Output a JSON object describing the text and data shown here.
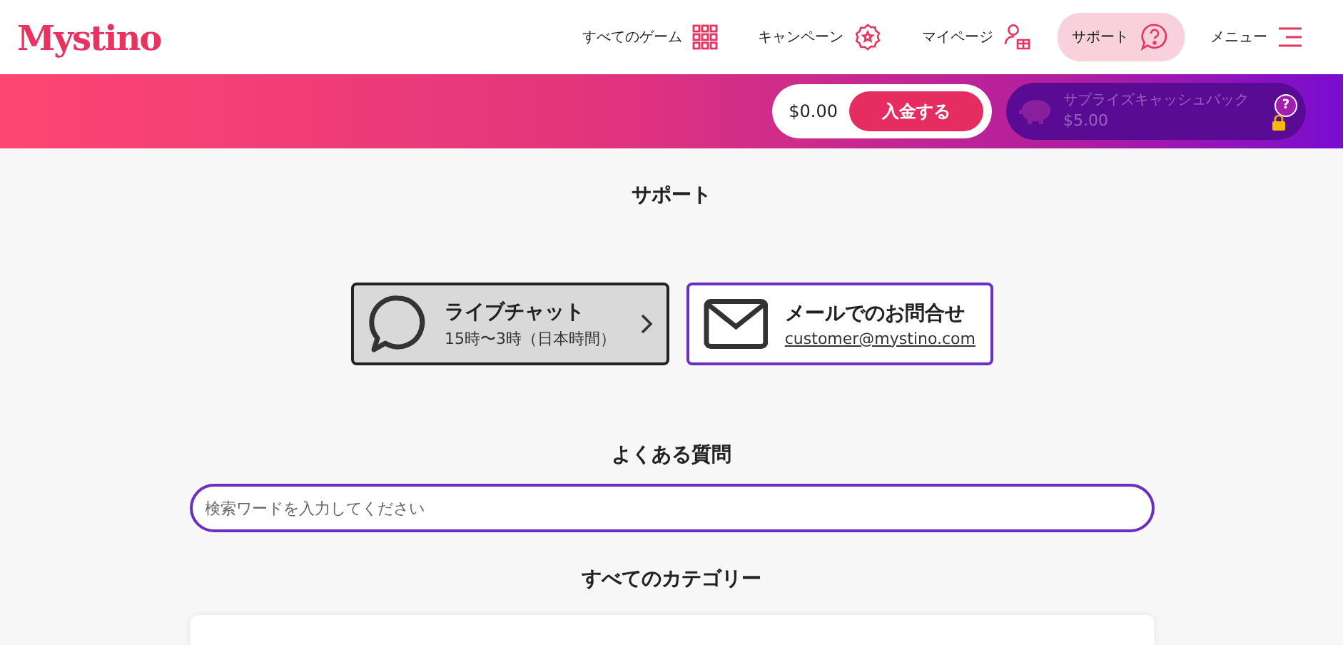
{
  "logo": "Mystino",
  "nav": [
    {
      "label": "すべてのゲーム",
      "kind": "grid",
      "selected": false
    },
    {
      "label": "キャンペーン",
      "kind": "badge",
      "selected": false
    },
    {
      "label": "マイページ",
      "kind": "user",
      "selected": false
    },
    {
      "label": "サポート",
      "kind": "help",
      "selected": true
    },
    {
      "label": "メニュー",
      "kind": "menu",
      "selected": false
    }
  ],
  "balance": {
    "amount": "$0.00",
    "deposit_button": "入金する"
  },
  "cashback": {
    "title": "サプライズキャッシュバック",
    "amount": "$5.00",
    "locked": true,
    "help": "?"
  },
  "page_title": "サポート",
  "contacts": [
    {
      "kind": "chat",
      "title": "ライブチャット",
      "subtitle": "15時〜3時（日本時間）"
    },
    {
      "kind": "mail",
      "title": "メールでのお問合せ",
      "subtitle": "customer@mystino.com"
    }
  ],
  "faq": {
    "title": "よくある質問",
    "search": {
      "placeholder": "検索ワードを入力してください"
    }
  },
  "categories": {
    "title": "すべてのカテゴリー"
  }
}
